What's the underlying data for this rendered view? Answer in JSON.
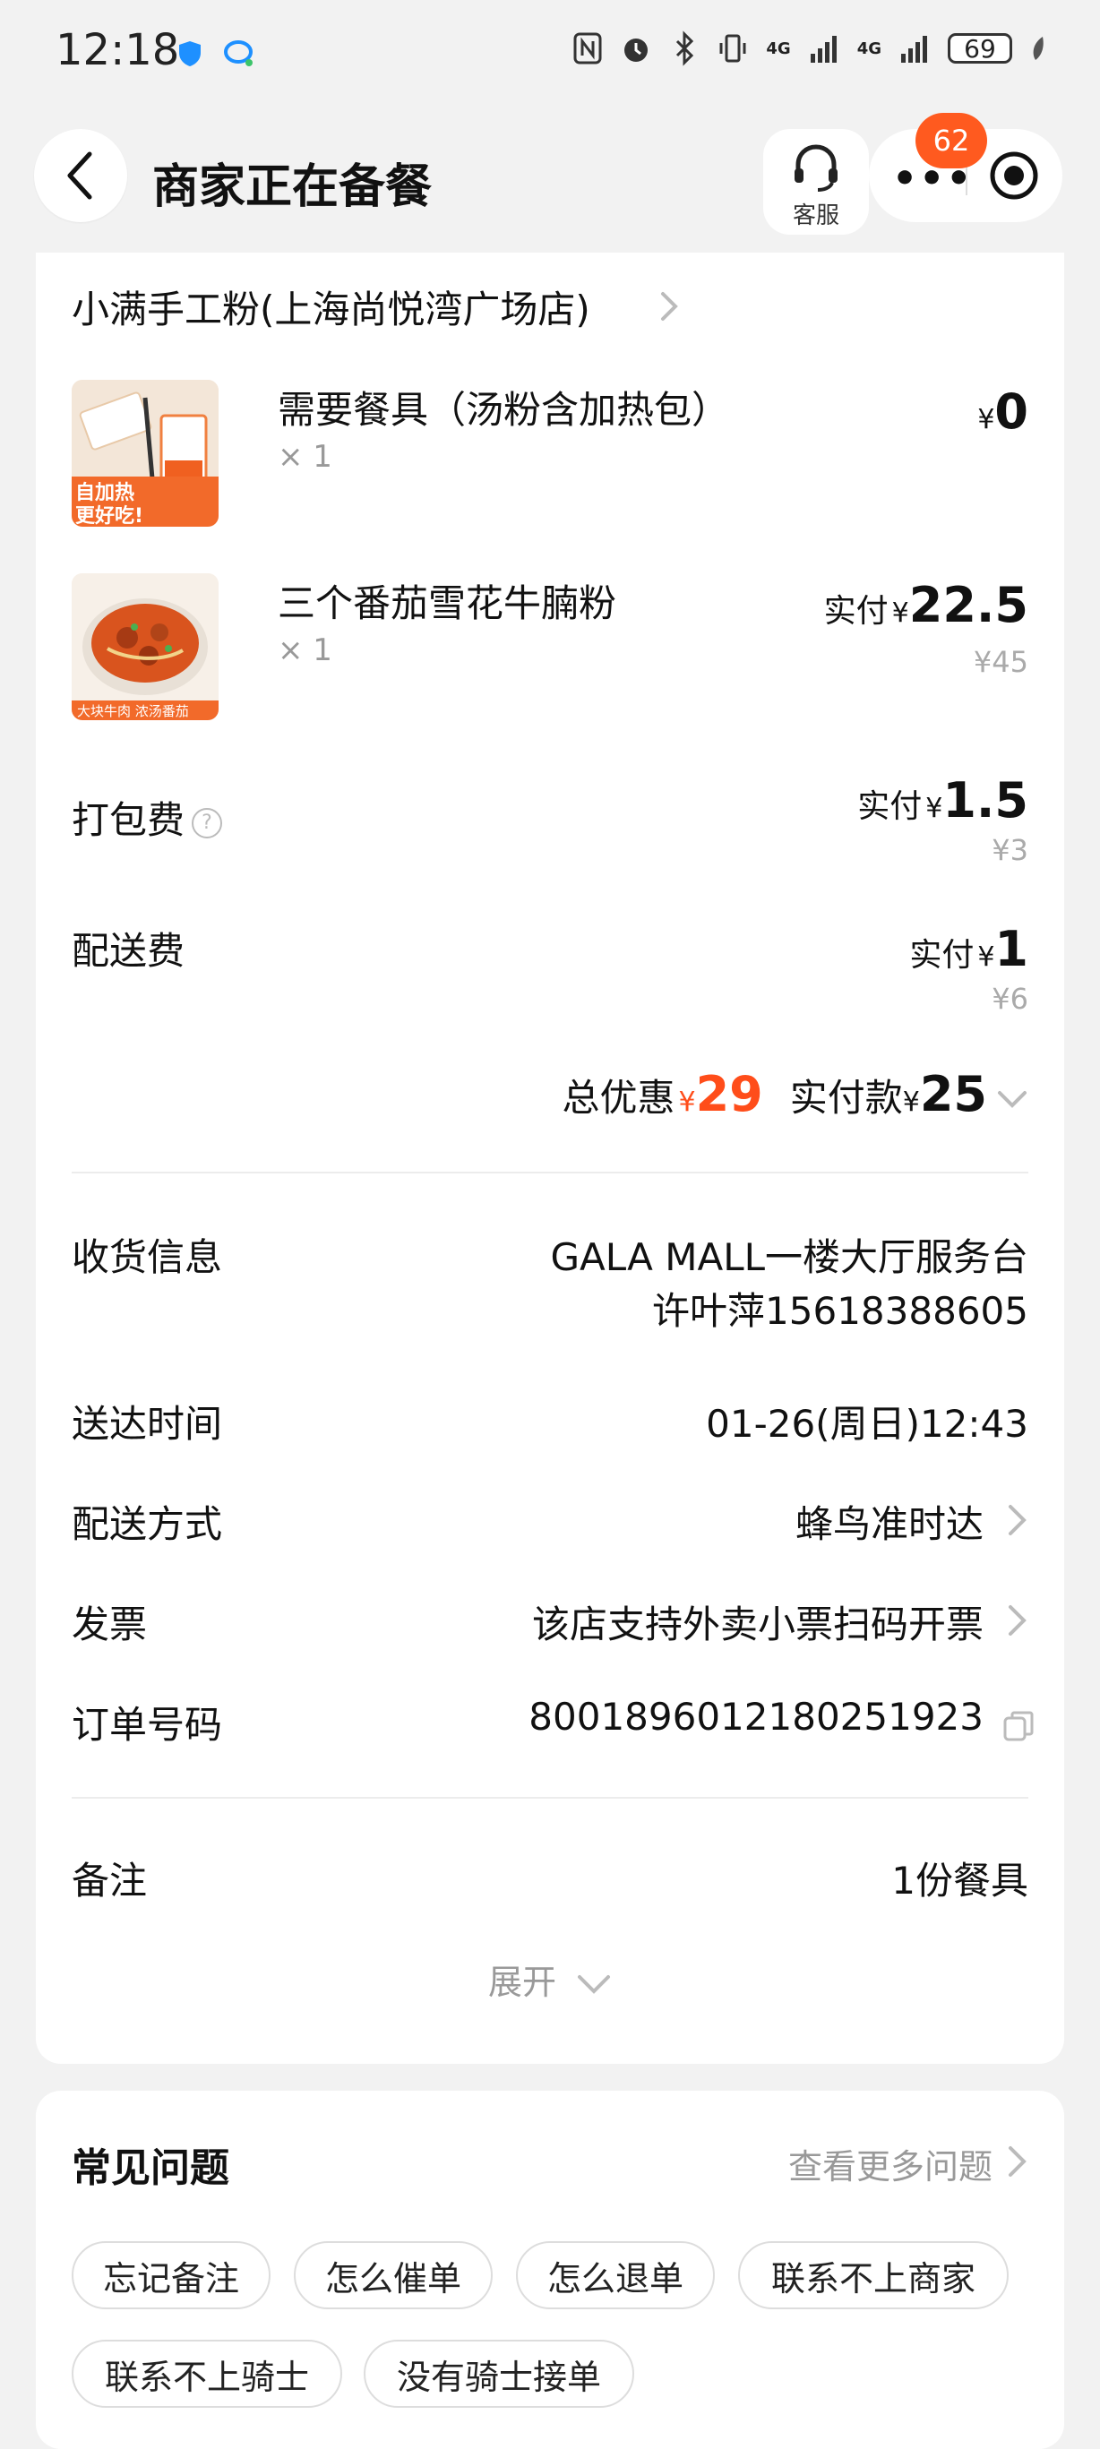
{
  "status_bar": {
    "time": "12:18",
    "net1": "4G",
    "net2": "4G",
    "battery": "69"
  },
  "header": {
    "title": "商家正在备餐",
    "service_label": "客服",
    "badge": "62",
    "more_dots": "•••"
  },
  "store": {
    "name": "小满手工粉(上海尚悦湾广场店)"
  },
  "items": [
    {
      "name": "需要餐具（汤粉含加热包）",
      "qty": "× 1",
      "price_prefix": "",
      "currency": "¥",
      "price": "0",
      "original": "",
      "thumb_text_1": "自加热",
      "thumb_text_2": "更好吃!"
    },
    {
      "name": "三个番茄雪花牛腩粉",
      "qty": "× 1",
      "price_prefix": "实付",
      "currency": "¥",
      "price": "22.5",
      "original": "¥45",
      "thumb_text_1": "大块牛肉 浓汤番茄"
    }
  ],
  "fees": {
    "packing": {
      "label": "打包费",
      "help": "?",
      "prefix": "实付",
      "currency": "¥",
      "price": "1.5",
      "original": "¥3"
    },
    "delivery": {
      "label": "配送费",
      "prefix": "实付",
      "currency": "¥",
      "price": "1",
      "original": "¥6"
    }
  },
  "total": {
    "discount_label": "总优惠",
    "discount_currency": "¥",
    "discount": "29",
    "paid_label": "实付款",
    "paid_currency": "¥",
    "paid": "25"
  },
  "info": {
    "address_label": "收货信息",
    "address_line1": "GALA MALL一楼大厅服务台",
    "address_line2": "许叶萍15618388605",
    "time_label": "送达时间",
    "time_value": "01-26(周日)12:43",
    "method_label": "配送方式",
    "method_value": "蜂鸟准时达",
    "invoice_label": "发票",
    "invoice_value": "该店支持外卖小票扫码开票",
    "order_label": "订单号码",
    "order_value": "8001896012180251923",
    "note_label": "备注",
    "note_value": "1份餐具",
    "expand_label": "展开"
  },
  "faq": {
    "title": "常见问题",
    "more": "查看更多问题",
    "chips": [
      "忘记备注",
      "怎么催单",
      "怎么退单",
      "联系不上商家",
      "联系不上骑士",
      "没有骑士接单"
    ]
  },
  "colors": {
    "accent": "#ff4d1a",
    "badge": "#ff5a1f"
  }
}
